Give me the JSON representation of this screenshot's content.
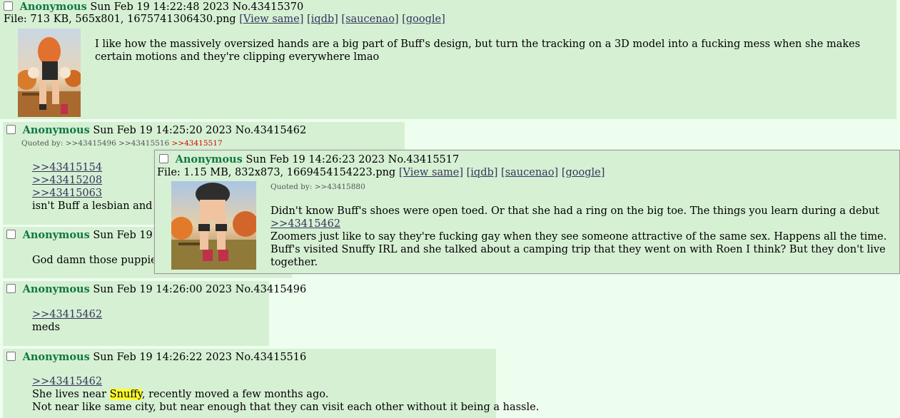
{
  "posts": [
    {
      "name": "Anonymous",
      "datetime": "Sun Feb 19 14:22:48 2023",
      "no": "No.43415370",
      "file": {
        "prefix": "File: 713 KB, 565x801, 1675741306430.png",
        "view_same": "[View same]",
        "iqdb": "[iqdb]",
        "saucenao": "[saucenao]",
        "google": "[google]"
      },
      "text": "I like how the massively oversized hands are a big part of Buff's design, but turn the tracking on a 3D model into a fucking mess when she makes certain motions and they're clipping everywhere lmao"
    },
    {
      "name": "Anonymous",
      "datetime": "Sun Feb 19 14:25:20 2023",
      "no": "No.43415462",
      "quoted_by_label": "Quoted by:",
      "quoted_by": [
        ">>43415496",
        ">>43415516",
        ">>43415517"
      ],
      "links": [
        ">>43415154",
        ">>43415208",
        ">>43415063"
      ],
      "text": "isn't Buff a lesbian and live"
    },
    {
      "name": "Anonymous",
      "datetime": "Sun Feb 19 14:2",
      "text": "God damn those puppies h"
    },
    {
      "name": "Anonymous",
      "datetime": "Sun Feb 19 14:26:00 2023",
      "no": "No.43415496",
      "links": [
        ">>43415462"
      ],
      "text": "meds"
    },
    {
      "name": "Anonymous",
      "datetime": "Sun Feb 19 14:26:22 2023",
      "no": "No.43415516",
      "links": [
        ">>43415462"
      ],
      "line1_before": "She lives near ",
      "line1_highlight": "Snuffy",
      "line1_after": ", recently moved a few months ago.",
      "line2": "Not near like same city, but near enough that they can visit each other without it being a hassle."
    }
  ],
  "popup": {
    "name": "Anonymous",
    "datetime": "Sun Feb 19 14:26:23 2023",
    "no": "No.43415517",
    "file": {
      "prefix": "File: 1.15 MB, 832x873, 1669454154223.png",
      "view_same": "[View same]",
      "iqdb": "[iqdb]",
      "saucenao": "[saucenao]",
      "google": "[google]"
    },
    "quoted_by_label": "Quoted by:",
    "quoted_by": [
      ">>43415880"
    ],
    "line1": "Didn't know Buff's shoes were open toed. Or that she had a ring on the big toe. The things you learn during a debut",
    "link": ">>43415462",
    "line2": "Zoomers just like to say they're fucking gay when they see someone attractive of the same sex. Happens all the time. Buff's visited Snuffy IRL and she talked about a camping trip that they went on with Roen I think? But they don't live together."
  },
  "colors": {
    "post_bg": "#d6f0d4",
    "page_bg": "#eefeee",
    "name": "#117743",
    "link": "#34345c",
    "quoted_by_self": "#dd0000",
    "highlight": "#ffff30"
  }
}
